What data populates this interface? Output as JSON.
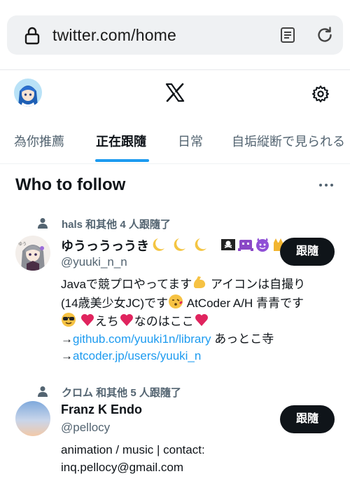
{
  "browser": {
    "url": "twitter.com/home",
    "icons": [
      "lock-icon",
      "reader-icon",
      "reload-icon"
    ]
  },
  "header": {
    "logo": "X",
    "icons": [
      "avatar",
      "x-logo-icon",
      "gear-icon"
    ]
  },
  "tabs": [
    {
      "label": "為你推薦",
      "active": false
    },
    {
      "label": "正在跟隨",
      "active": true
    },
    {
      "label": "日常",
      "active": false
    },
    {
      "label": "自垢縦断で見られる",
      "active": false
    }
  ],
  "who_to_follow": {
    "title": "Who to follow",
    "users": [
      {
        "social_context": "hals 和其他 4 人跟隨了",
        "display_name": "ゆうっうっうき",
        "handle": "@yuuki_n_n",
        "follow_label": "跟隨",
        "bio": {
          "line1": "Javaで競プロやってます",
          "line2a": " アイコンは自撮り",
          "line2b": "(14歳美少女JC)です",
          "line2c": " AtCoder A/H 青青です",
          "line3a": "えち",
          "line3b": "なのはここ",
          "arrow": "→",
          "link1": "github.com/yuuki1n/library",
          "after_link1": " あっとこ寺",
          "link2": "atcoder.jp/users/yuuki_n"
        }
      },
      {
        "social_context": "クロム 和其他 5 人跟隨了",
        "display_name": "Franz K Endo",
        "handle": "@pellocy",
        "follow_label": "跟隨",
        "bio": {
          "line1": "animation / music | contact:",
          "line2": "inq.pellocy@gmail.com"
        }
      }
    ]
  },
  "colors": {
    "accent": "#1d9bf0",
    "text": "#0f1419",
    "muted": "#536471",
    "button": "#0f1419"
  }
}
